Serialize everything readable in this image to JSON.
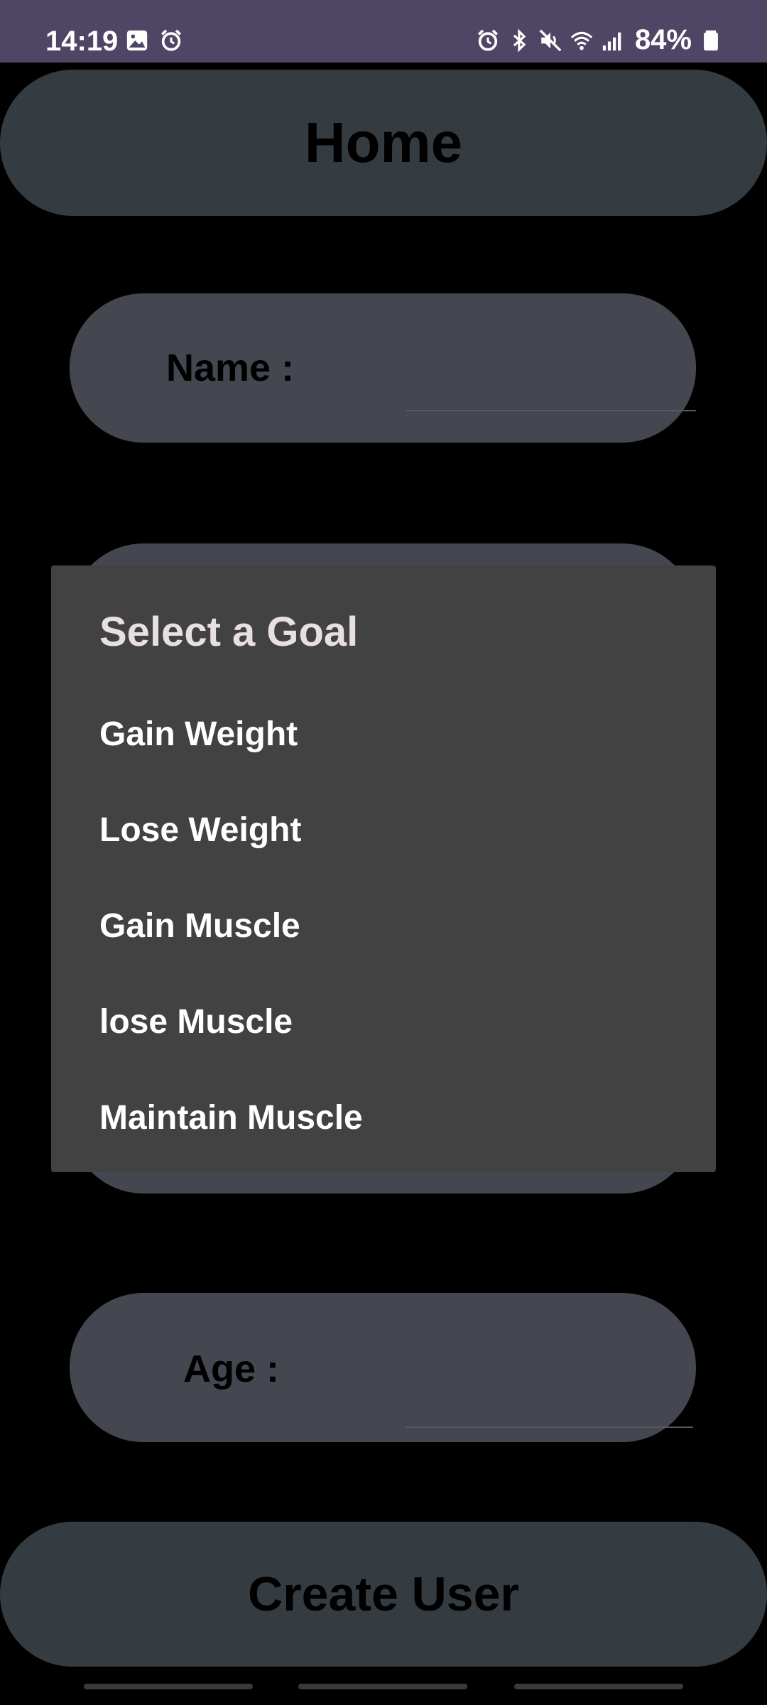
{
  "status_bar": {
    "time": "14:19",
    "left_icons": [
      "image-icon",
      "alarm-clock-icon"
    ],
    "right_icons": [
      "alarm-icon",
      "bluetooth-icon",
      "mute-icon",
      "wifi-icon",
      "signal-icon",
      "battery-icon"
    ],
    "battery": "84%"
  },
  "header": {
    "title": "Home"
  },
  "form": {
    "name_label": "Name :",
    "name_value": "",
    "age_label": "Age :",
    "age_value": ""
  },
  "dialog": {
    "title": "Select a Goal",
    "options": [
      "Gain Weight",
      "Lose Weight",
      "Gain Muscle",
      "lose Muscle",
      "Maintain Muscle"
    ]
  },
  "actions": {
    "create_user_label": "Create User"
  },
  "colors": {
    "status_bar": "#4f4665",
    "header_bg": "#343c41",
    "field_bg": "#44474f",
    "dialog_bg": "#424242",
    "dialog_title": "#e8dfe3",
    "background": "#000000"
  }
}
